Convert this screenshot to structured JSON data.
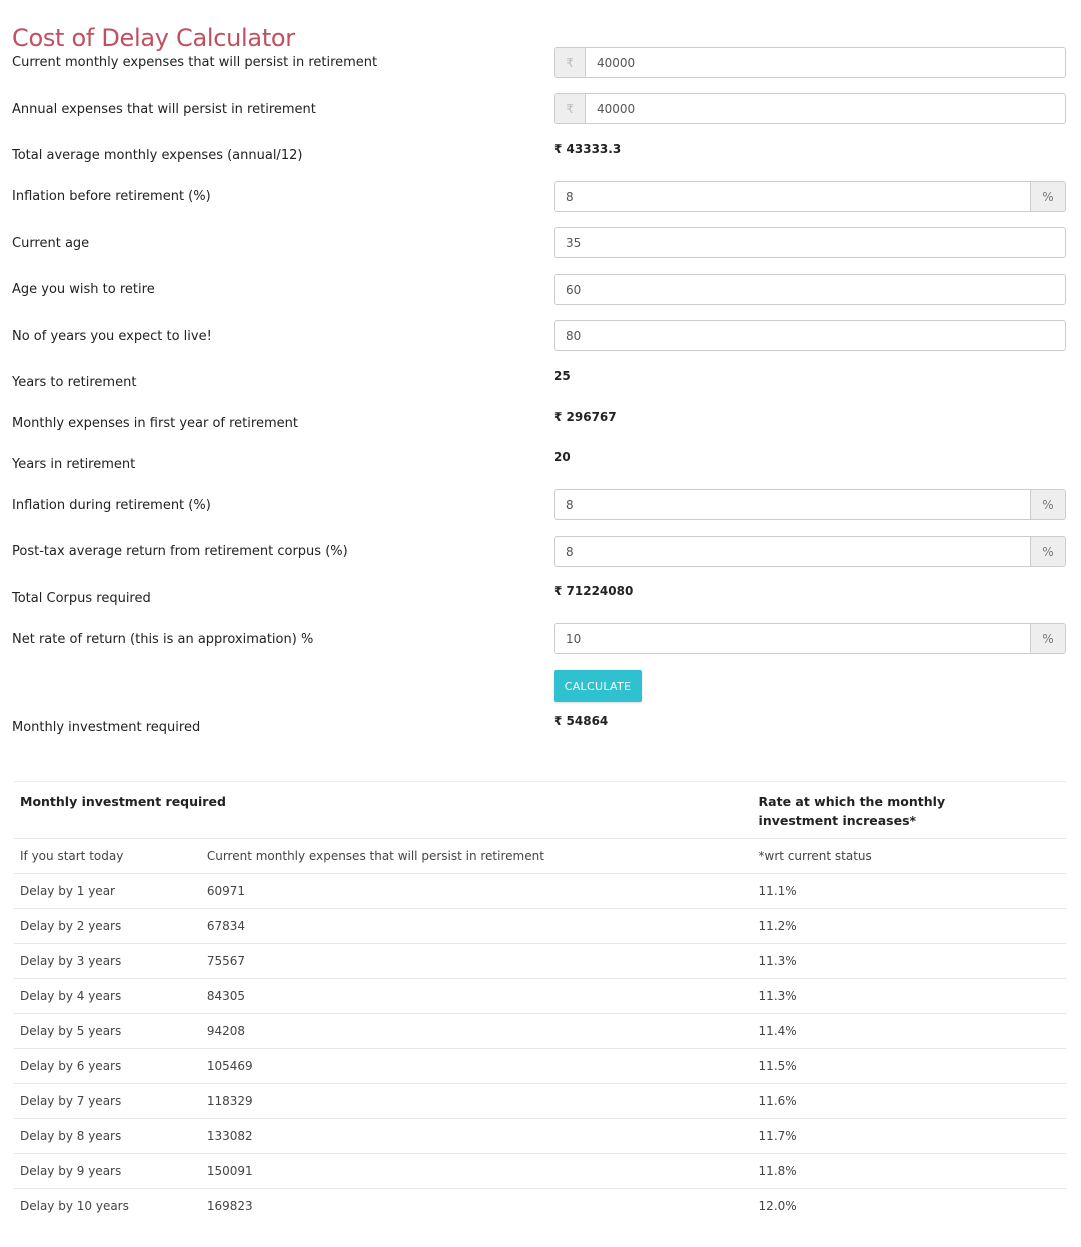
{
  "page": {
    "title": "Cost of Delay Calculator"
  },
  "currency_symbol": "₹",
  "percent_symbol": "%",
  "form": {
    "current_monthly_expenses": {
      "label": "Current monthly expenses that will persist in retirement",
      "value": "40000"
    },
    "annual_expenses": {
      "label": "Annual expenses that will persist in retirement",
      "value": "40000"
    },
    "total_avg_monthly": {
      "label": "Total average monthly expenses (annual/12)",
      "value": "₹ 43333.3"
    },
    "inflation_before": {
      "label": "Inflation before retirement (%)",
      "value": "8"
    },
    "current_age": {
      "label": "Current age",
      "value": "35"
    },
    "retire_age": {
      "label": "Age you wish to retire",
      "value": "60"
    },
    "expected_life": {
      "label": "No of years you expect to live!",
      "value": "80"
    },
    "years_to_retirement": {
      "label": "Years to retirement",
      "value": "25"
    },
    "monthly_expenses_first_year": {
      "label": "Monthly expenses in first year of retirement",
      "value": "₹ 296767"
    },
    "years_in_retirement": {
      "label": "Years in retirement",
      "value": "20"
    },
    "inflation_during": {
      "label": "Inflation during retirement (%)",
      "value": "8"
    },
    "post_tax_return": {
      "label": "Post-tax average return from retirement corpus (%)",
      "value": "8"
    },
    "total_corpus": {
      "label": "Total Corpus required",
      "value": "₹ 71224080"
    },
    "net_rate_of_return": {
      "label": "Net rate of return (this is an approximation) %",
      "value": "10"
    },
    "calculate_label": "CALCULATE",
    "monthly_investment": {
      "label": "Monthly investment required",
      "value": "₹ 54864"
    }
  },
  "table": {
    "headers": [
      "Monthly investment required",
      "",
      "Rate at which the monthly investment increases*"
    ],
    "rows": [
      [
        "If you start today",
        "Current monthly expenses that will persist in retirement",
        "*wrt current status"
      ],
      [
        "Delay by 1 year",
        "60971",
        "11.1%"
      ],
      [
        "Delay by 2 years",
        "67834",
        "11.2%"
      ],
      [
        "Delay by 3 years",
        "75567",
        "11.3%"
      ],
      [
        "Delay by 4 years",
        "84305",
        "11.3%"
      ],
      [
        "Delay by 5 years",
        "94208",
        "11.4%"
      ],
      [
        "Delay by 6 years",
        "105469",
        "11.5%"
      ],
      [
        "Delay by 7 years",
        "118329",
        "11.6%"
      ],
      [
        "Delay by 8 years",
        "133082",
        "11.7%"
      ],
      [
        "Delay by 9 years",
        "150091",
        "11.8%"
      ],
      [
        "Delay by 10 years",
        "169823",
        "12.0%"
      ]
    ]
  },
  "colors": {
    "title": "#c0505f",
    "button": "#2fc1cf"
  }
}
